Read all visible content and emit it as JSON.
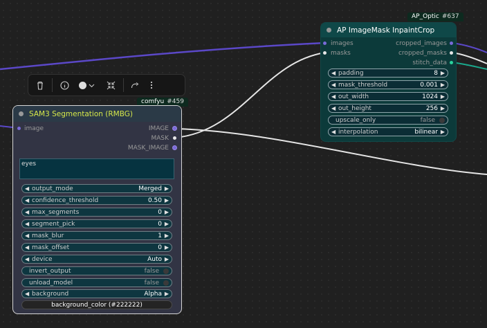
{
  "toolbar": {
    "buttons": [
      "trash-icon",
      "info-icon",
      "color-picker-icon",
      "chevron-down-icon",
      "collapse-icon",
      "bypass-icon",
      "more-icon"
    ]
  },
  "ap_node": {
    "badge_name": "AP_Optic",
    "badge_id": "#637",
    "title": "AP ImageMask InpaintCrop",
    "inputs": [
      "images",
      "masks"
    ],
    "outputs": [
      "cropped_images",
      "cropped_masks",
      "stitch_data"
    ],
    "widgets": [
      {
        "label": "padding",
        "value": "8"
      },
      {
        "label": "mask_threshold",
        "value": "0.001"
      },
      {
        "label": "out_width",
        "value": "1024"
      },
      {
        "label": "out_height",
        "value": "256"
      },
      {
        "label": "upscale_only",
        "value": "false"
      },
      {
        "label": "interpolation",
        "value": "bilinear"
      }
    ]
  },
  "sam_node": {
    "badge_name": "comfyu",
    "badge_id": "#459",
    "title": "SAM3 Segmentation (RMBG)",
    "inputs": [
      "image"
    ],
    "outputs": [
      "IMAGE",
      "MASK",
      "MASK_IMAGE"
    ],
    "prompt_text": "eyes",
    "widgets": [
      {
        "label": "output_mode",
        "value": "Merged"
      },
      {
        "label": "confidence_threshold",
        "value": "0.50"
      },
      {
        "label": "max_segments",
        "value": "0"
      },
      {
        "label": "segment_pick",
        "value": "0"
      },
      {
        "label": "mask_blur",
        "value": "1"
      },
      {
        "label": "mask_offset",
        "value": "0"
      },
      {
        "label": "device",
        "value": "Auto"
      },
      {
        "label": "invert_output",
        "value": "false"
      },
      {
        "label": "unload_model",
        "value": "false"
      },
      {
        "label": "background",
        "value": "Alpha"
      }
    ],
    "button_label": "background_color (#222222)"
  },
  "colors": {
    "image_link": "#5b48c8",
    "mask_link": "#e0e0e0",
    "stitch_link": "#1aa88c",
    "node_teal": "#0c3a3a",
    "node_slate": "#323444",
    "title_yellow": "#d6e84a"
  }
}
